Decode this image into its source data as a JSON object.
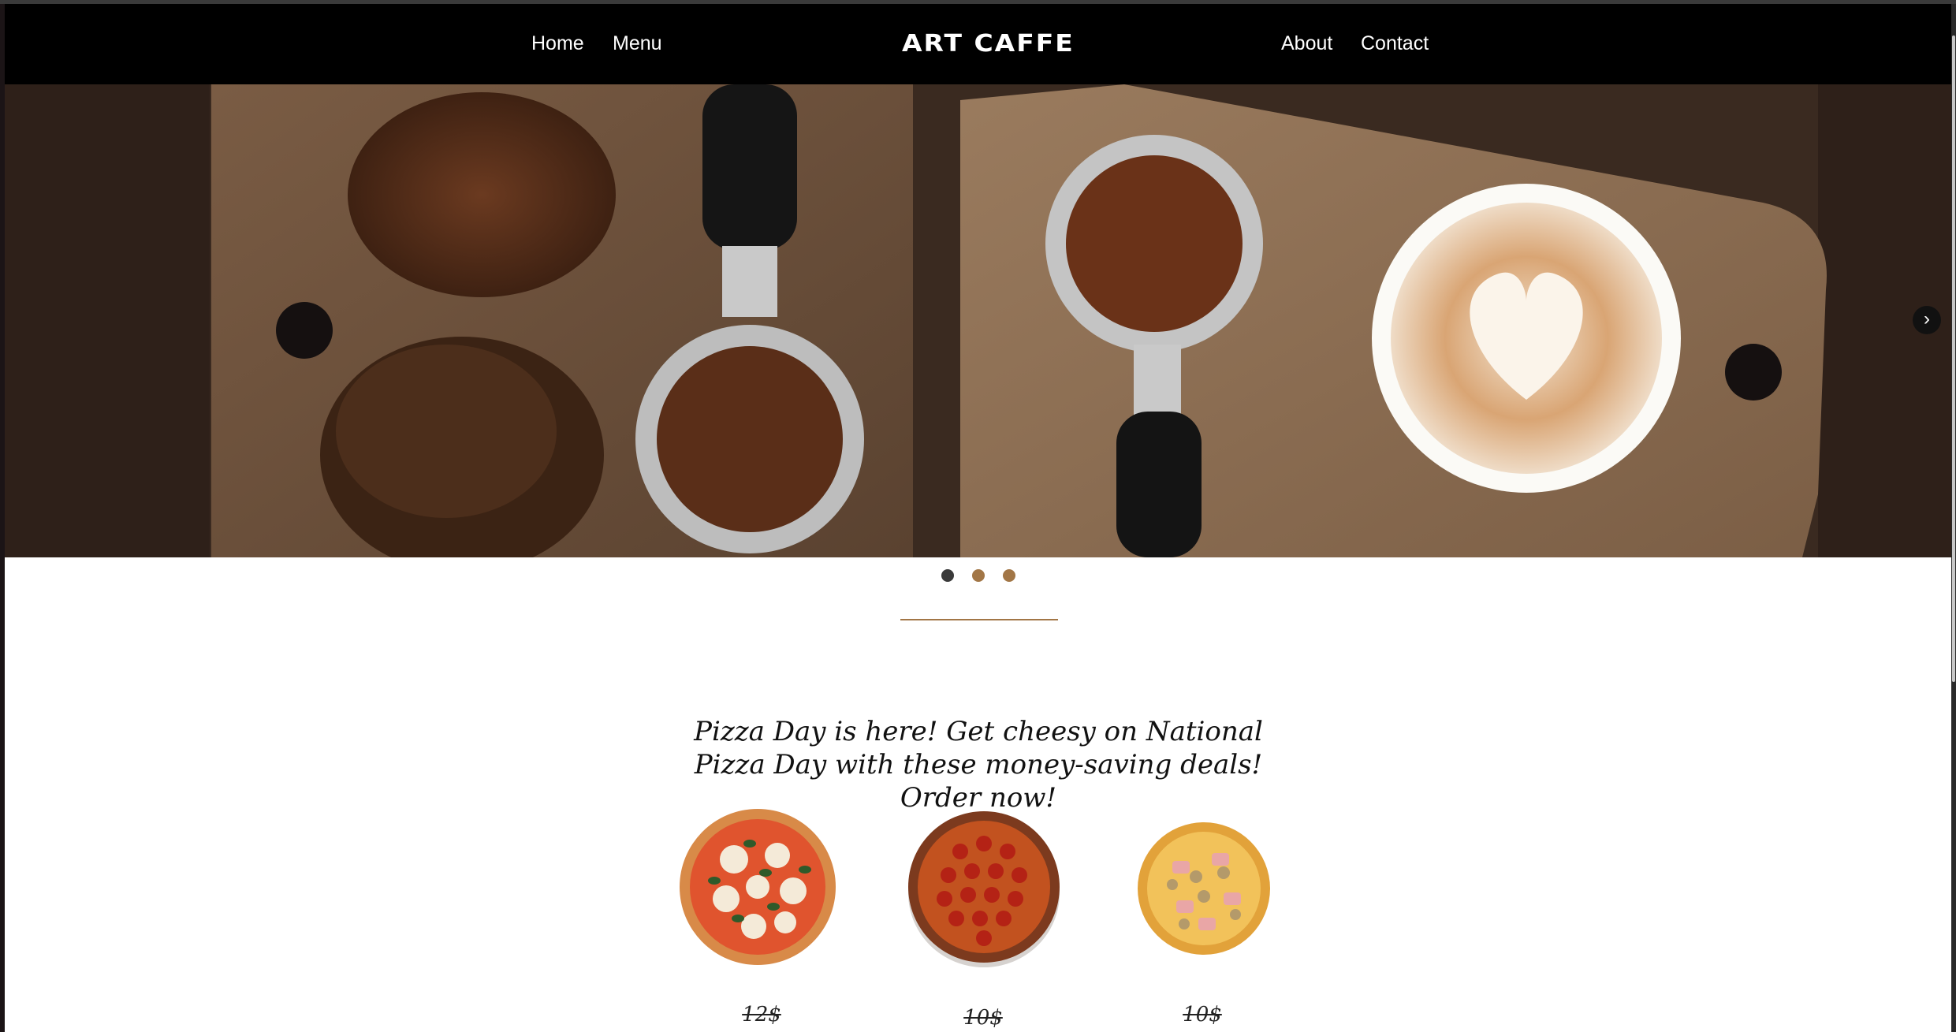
{
  "nav": {
    "links_left": [
      "Home",
      "Menu"
    ],
    "logo": "ART CAFFE",
    "links_right": [
      "About",
      "Contact"
    ]
  },
  "hero": {
    "carousel_slides": 3,
    "active_slide": 1,
    "next_icon": "chevron-right-icon"
  },
  "promo": {
    "text": "Pizza Day is here! Get cheesy on National Pizza Day with these money-saving deals! Order now!"
  },
  "pizzas": [
    {
      "name": "margherita",
      "price": "12$"
    },
    {
      "name": "pepperoni",
      "price": "10$"
    },
    {
      "name": "ham-and-mushroom",
      "price": "10$"
    }
  ],
  "colors": {
    "nav_bg": "#000000",
    "accent": "#a27646",
    "dot_active": "#3a3a3a",
    "dot_inactive": "#a27646"
  }
}
